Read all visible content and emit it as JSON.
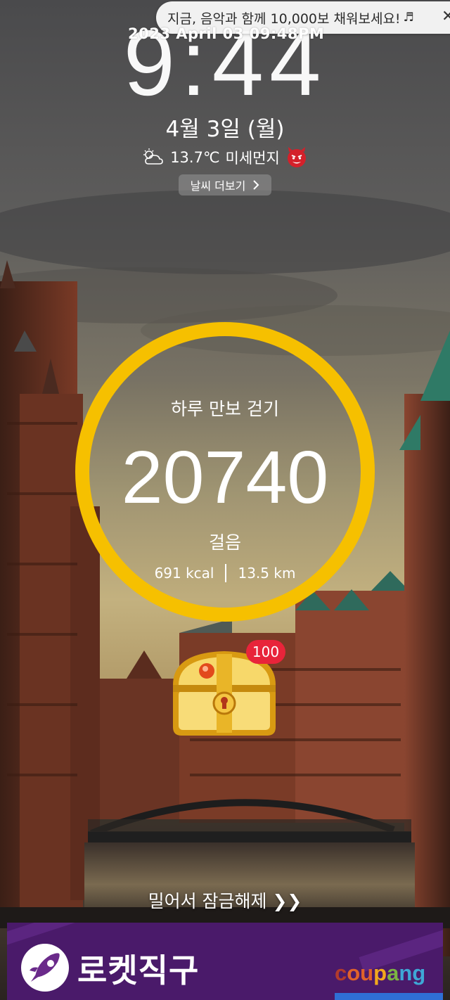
{
  "notification": {
    "text": "지금, 음악과 함께 10,000보 채워보세요!",
    "icon": "music-note-icon"
  },
  "recorder_overlay": "2023 April 03 09:48PM",
  "lock": {
    "time": "9:44",
    "date": "4월 3일 (월)",
    "weather_temp": "13.7℃",
    "dust_label": "미세먼지",
    "weather_more": "날씨 더보기"
  },
  "pedometer": {
    "title": "하루 만보 걷기",
    "steps": "20740",
    "unit": "걸음",
    "kcal": "691 kcal",
    "distance": "13.5 km",
    "ring_color": "#f6c000"
  },
  "reward": {
    "badge_count": "100",
    "icon": "treasure-chest-icon"
  },
  "unlock_hint": "밀어서 잠금해제 ❯❯",
  "ad": {
    "title": "로켓직구",
    "brand": "coupang",
    "bg_color": "#4a1a6a"
  }
}
